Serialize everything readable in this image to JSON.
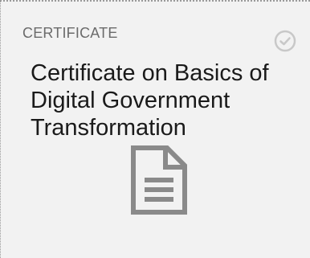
{
  "card": {
    "type_label": "CERTIFICATE",
    "title": "Certificate on Basics of Digital Government Transformation",
    "status_icon": "check-circle-icon",
    "content_icon": "document-icon",
    "colors": {
      "background": "#f2f2f2",
      "type_label": "#6b6b6b",
      "title": "#1a1a1a",
      "icon": "#8a8a8a",
      "status_icon": "#c8c8c8"
    }
  }
}
